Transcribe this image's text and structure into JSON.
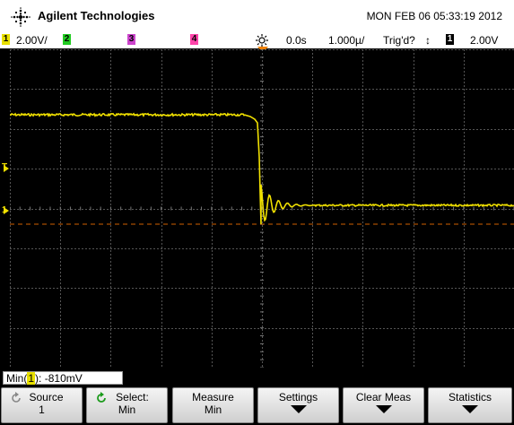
{
  "header": {
    "brand": "Agilent Technologies",
    "datetime": "MON FEB 06 05:33:19 2012",
    "logo_icon": "agilent-spark-icon"
  },
  "status_bar": {
    "channels": [
      {
        "num": "1",
        "scale": "2.00V/",
        "color": "#e8e000"
      },
      {
        "num": "2",
        "scale": "",
        "color": "#22cc22"
      },
      {
        "num": "3",
        "scale": "",
        "color": "#cc44cc"
      },
      {
        "num": "4",
        "scale": "",
        "color": "#ff44aa"
      }
    ],
    "run_icon": "sun-icon",
    "delay": "0.0s",
    "timebase": "1.000µ/",
    "trig_state": "Trig'd?",
    "trig_slope_icon": "updown-arrow-icon",
    "trig_source": "1",
    "trig_level": "2.00V"
  },
  "screen": {
    "markers": {
      "trigger": "T",
      "ground": "1"
    },
    "trace_color": "#f0e000"
  },
  "measurement": {
    "label": "Min(",
    "channel": "1",
    "suffix": "):",
    "value": "-810mV"
  },
  "softkeys": [
    {
      "label": "Source",
      "value": "1",
      "icon": "rotate-knob-icon"
    },
    {
      "label": "Select:",
      "value": "Min",
      "icon": "rotate-knob-icon-green"
    },
    {
      "label": "Measure",
      "value": "Min"
    },
    {
      "label": "Settings",
      "value": "",
      "icon": "down-arrow-icon"
    },
    {
      "label": "Clear Meas",
      "value": "",
      "icon": "down-arrow-icon"
    },
    {
      "label": "Statistics",
      "value": "",
      "icon": "down-arrow-icon"
    }
  ]
}
